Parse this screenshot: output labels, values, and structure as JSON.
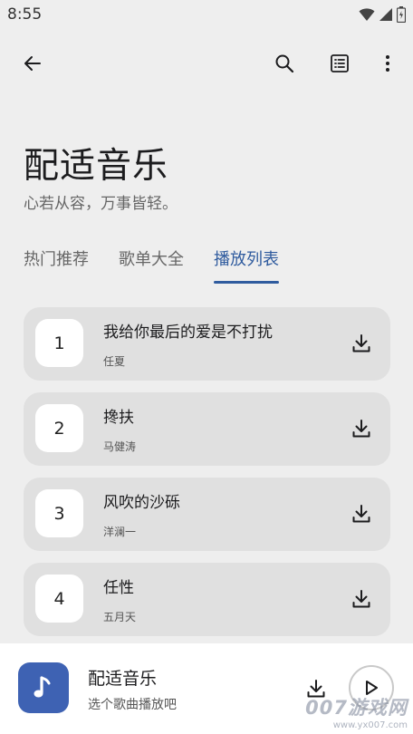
{
  "status": {
    "time": "8:55"
  },
  "app": {
    "title": "配适音乐",
    "subtitle": "心若从容，万事皆轻。"
  },
  "tabs": [
    {
      "label": "热门推荐",
      "active": false
    },
    {
      "label": "歌单大全",
      "active": false
    },
    {
      "label": "播放列表",
      "active": true
    }
  ],
  "songs": [
    {
      "index": "1",
      "title": "我给你最后的爱是不打扰",
      "artist": "任夏"
    },
    {
      "index": "2",
      "title": "搀扶",
      "artist": "马健涛"
    },
    {
      "index": "3",
      "title": "风吹的沙砾",
      "artist": "洋澜一"
    },
    {
      "index": "4",
      "title": "任性",
      "artist": "五月天"
    }
  ],
  "player": {
    "title": "配适音乐",
    "subtitle": "选个歌曲播放吧"
  },
  "watermark": {
    "text": "007游戏网",
    "url": "www.yx007.com"
  },
  "colors": {
    "accent": "#2f5b9e",
    "art_bg": "#3e62b3",
    "card_bg": "#e0e0e0",
    "page_bg": "#eeeeee"
  },
  "icons": [
    "wifi-icon",
    "signal-icon",
    "battery-icon",
    "back-arrow-icon",
    "search-icon",
    "list-view-icon",
    "more-vert-icon",
    "download-icon",
    "music-note-icon",
    "play-icon"
  ]
}
